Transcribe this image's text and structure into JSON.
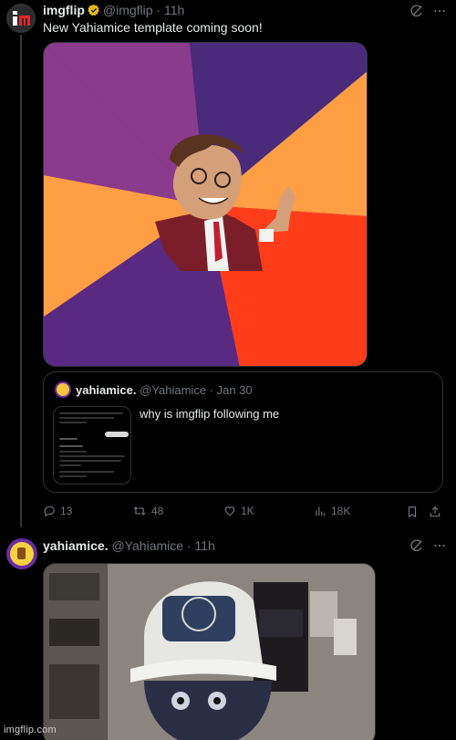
{
  "tweet1": {
    "name": "imgflip",
    "handle": "@imgflip",
    "time": "· 11h",
    "text": "New Yahiamice template coming soon!",
    "quote": {
      "name": "yahiamice.",
      "handle": "@Yahiamice",
      "time": "· Jan 30",
      "text": "why is imgflip following me"
    },
    "actions": {
      "replies": "13",
      "reposts": "48",
      "likes": "1K",
      "views": "18K"
    }
  },
  "tweet2": {
    "name": "yahiamice.",
    "handle": "@Yahiamice",
    "time": "· 11h"
  },
  "colors": {
    "background": "#000000",
    "text": "#e7e9ea",
    "muted": "#71767b",
    "verified": "#e2b719",
    "border": "#2f3336"
  },
  "icons": {
    "grok": "grok-icon",
    "reply": "reply-icon",
    "repost": "repost-icon",
    "like": "heart-icon",
    "views": "views-chart-icon",
    "bookmark": "bookmark-icon",
    "share": "share-icon"
  },
  "watermark": "imgflip.com"
}
